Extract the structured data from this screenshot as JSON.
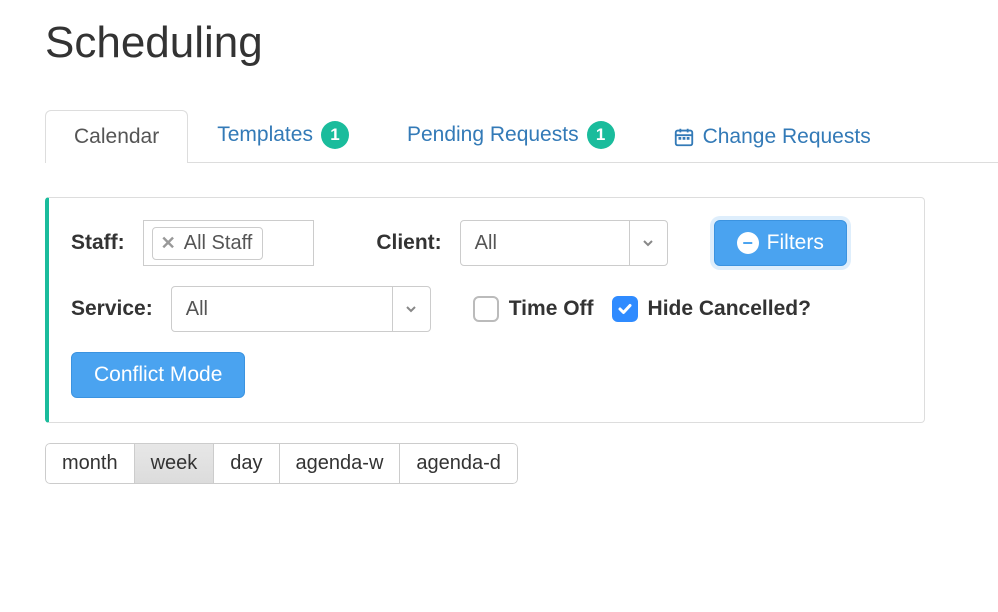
{
  "page": {
    "title": "Scheduling"
  },
  "tabs": {
    "calendar": {
      "label": "Calendar"
    },
    "templates": {
      "label": "Templates",
      "badge": "1"
    },
    "pending": {
      "label": "Pending Requests",
      "badge": "1"
    },
    "change": {
      "label": "Change Requests"
    }
  },
  "filters": {
    "staff_label": "Staff:",
    "staff_token": "All Staff",
    "client_label": "Client:",
    "client_value": "All",
    "filters_btn": "Filters",
    "service_label": "Service:",
    "service_value": "All",
    "time_off_label": "Time Off",
    "time_off_checked": false,
    "hide_cancelled_label": "Hide Cancelled?",
    "hide_cancelled_checked": true,
    "conflict_mode_btn": "Conflict Mode"
  },
  "views": {
    "month": "month",
    "week": "week",
    "day": "day",
    "agenda_w": "agenda-w",
    "agenda_d": "agenda-d",
    "active": "week"
  }
}
